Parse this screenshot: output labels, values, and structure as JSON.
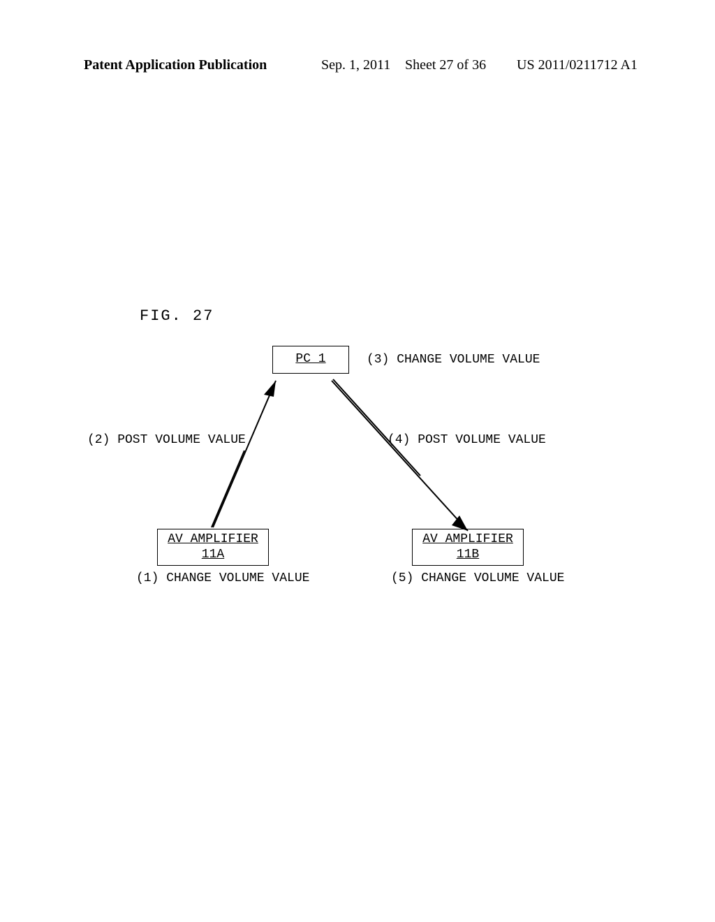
{
  "header": {
    "left": "Patent Application Publication",
    "center": "Sep. 1, 2011",
    "sheet": "Sheet 27 of 36",
    "pubno": "US 2011/0211712 A1"
  },
  "figure_label": "FIG.  27",
  "nodes": {
    "pc": {
      "label": "PC 1"
    },
    "ampA": {
      "label_line1": "AV AMPLIFIER",
      "label_line2": "11A"
    },
    "ampB": {
      "label_line1": "AV AMPLIFIER",
      "label_line2": "11B"
    }
  },
  "annotations": {
    "a1": "(1) CHANGE VOLUME VALUE",
    "a2": "(2) POST VOLUME VALUE",
    "a3": "(3) CHANGE VOLUME VALUE",
    "a4": "(4) POST VOLUME VALUE",
    "a5": "(5) CHANGE VOLUME VALUE"
  }
}
